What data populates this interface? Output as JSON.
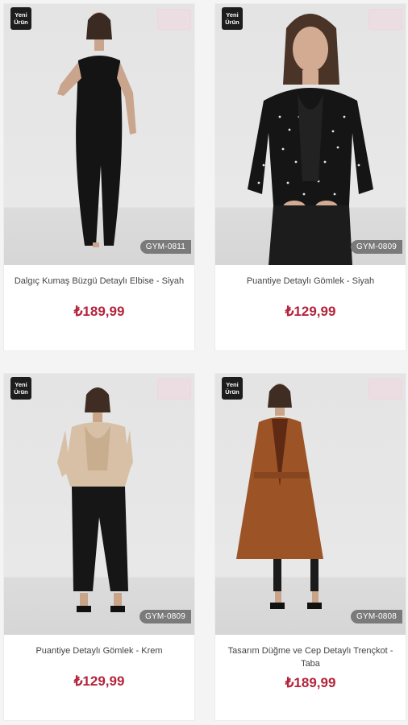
{
  "colors": {
    "price": "#b3243b",
    "badge_bg": "#1d1d1d",
    "code_tag_bg": "#7a7a7a"
  },
  "products": [
    {
      "new_badge": [
        "Yeni",
        "Ürün"
      ],
      "code": "GYM-0811",
      "name": "Dalgıç Kumaş Büzgü Detaylı Elbise - Siyah",
      "price": "₺189,99"
    },
    {
      "new_badge": [
        "Yeni",
        "Ürün"
      ],
      "code": "GYM-0809",
      "name": "Puantiye Detaylı Gömlek - Siyah",
      "price": "₺129,99"
    },
    {
      "new_badge": [
        "Yeni",
        "Ürün"
      ],
      "code": "GYM-0809",
      "name": "Puantiye Detaylı Gömlek - Krem",
      "price": "₺129,99"
    },
    {
      "new_badge": [
        "Yeni",
        "Ürün"
      ],
      "code": "GYM-0808",
      "name": "Tasarım Düğme ve Cep Detaylı Trençkot - Taba",
      "price": "₺189,99"
    }
  ]
}
